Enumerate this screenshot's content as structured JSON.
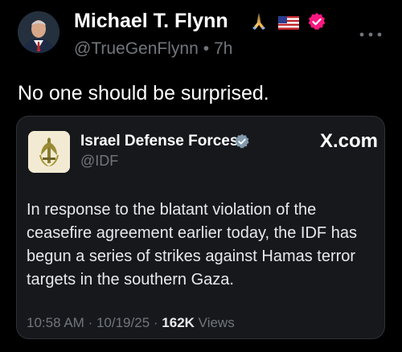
{
  "post": {
    "author_name": "Michael T. Flynn",
    "author_emojis": [
      "folded-hands",
      "us-flag"
    ],
    "handle": "@TrueGenFlynn",
    "separator": "•",
    "time_ago": "7h",
    "text": "No one should be surprised.",
    "more_icon": "more-horizontal-icon"
  },
  "quote": {
    "author_name": "Israel Defense Forces",
    "handle": "@IDF",
    "source": "X.com",
    "body": "In response to the blatant violation of the ceasefire agreement earlier today, the IDF has begun a series of strikes against Hamas terror targets in the southern Gaza.",
    "time": "10:58 AM",
    "date": "10/19/25",
    "meta_sep": "·",
    "views_count": "162K",
    "views_label": "Views"
  },
  "colors": {
    "background": "#000000",
    "card": "#16181c",
    "muted_text": "#71767b",
    "verified_badge": "#f91880"
  }
}
